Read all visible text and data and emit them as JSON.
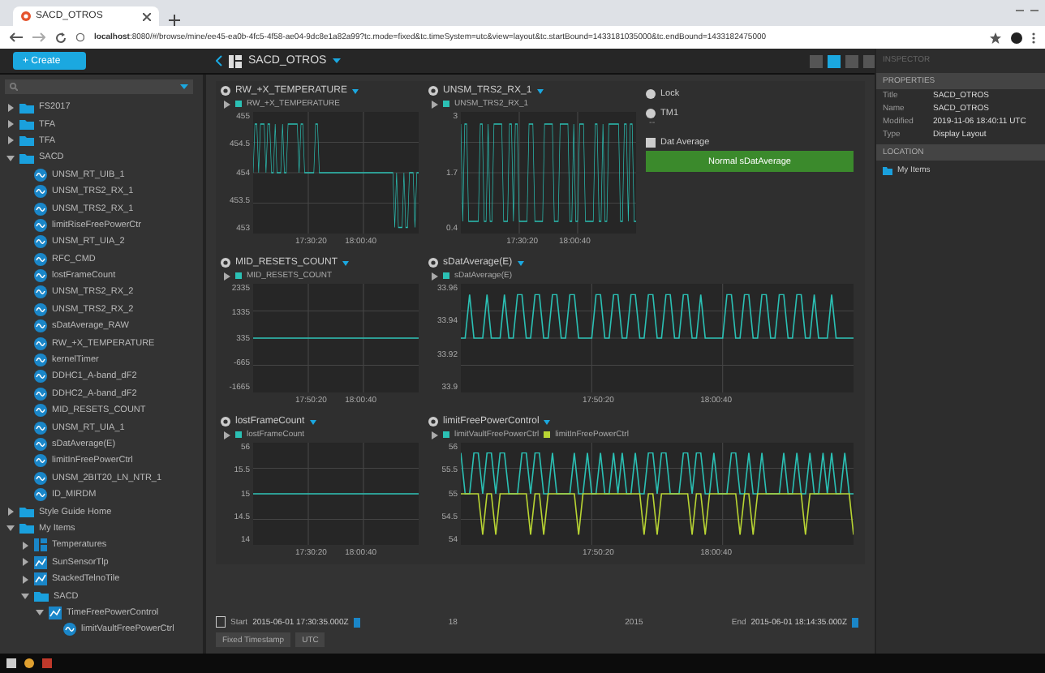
{
  "browser": {
    "tab_title": "SACD_OTROS",
    "url_host": "localhost",
    "url_rest": ":8080/#/browse/mine/ee45-ea0b-4fc5-4f58-ae04-9dc8e1a82a99?tc.mode=fixed&tc.timeSystem=utc&view=layout&tc.startBound=1433181035000&tc.endBound=1433182475000"
  },
  "create_button": "+ Create",
  "tree": [
    {
      "label": "FS2017",
      "kind": "folder",
      "expanded": false
    },
    {
      "label": "TFA",
      "kind": "folder",
      "expanded": false
    },
    {
      "label": "TFA",
      "kind": "folder",
      "expanded": false
    },
    {
      "label": "SACD",
      "kind": "folder",
      "expanded": true,
      "children": [
        {
          "label": "UNSM_RT_UIB_1",
          "kind": "telemetry"
        },
        {
          "label": "UNSM_TRS2_RX_1",
          "kind": "telemetry"
        },
        {
          "label": "UNSM_TRS2_RX_1",
          "kind": "telemetry"
        },
        {
          "label": "limitRiseFreePowerCtr",
          "kind": "telemetry"
        },
        {
          "label": "UNSM_RT_UIA_2",
          "kind": "telemetry"
        },
        {
          "label": "RFC_CMD",
          "kind": "telemetry"
        },
        {
          "label": "lostFrameCount",
          "kind": "telemetry"
        },
        {
          "label": "UNSM_TRS2_RX_2",
          "kind": "telemetry"
        },
        {
          "label": "UNSM_TRS2_RX_2",
          "kind": "telemetry"
        },
        {
          "label": "sDatAverage_RAW",
          "kind": "telemetry"
        },
        {
          "label": "RW_+X_TEMPERATURE",
          "kind": "telemetry"
        },
        {
          "label": "kernelTimer",
          "kind": "telemetry"
        },
        {
          "label": "DDHC1_A-band_dF2",
          "kind": "telemetry"
        },
        {
          "label": "DDHC2_A-band_dF2",
          "kind": "telemetry"
        },
        {
          "label": "MID_RESETS_COUNT",
          "kind": "telemetry"
        },
        {
          "label": "UNSM_RT_UIA_1",
          "kind": "telemetry"
        },
        {
          "label": "sDatAverage(E)",
          "kind": "telemetry"
        },
        {
          "label": "limitInFreePowerCtrl",
          "kind": "telemetry"
        },
        {
          "label": "UNSM_2BIT20_LN_NTR_1",
          "kind": "telemetry"
        },
        {
          "label": "ID_MIRDM",
          "kind": "telemetry"
        }
      ]
    },
    {
      "label": "Style Guide Home",
      "kind": "folder",
      "expanded": false
    },
    {
      "label": "My Items",
      "kind": "folder",
      "expanded": true,
      "children": [
        {
          "label": "Temperatures",
          "kind": "layout",
          "expanded": false
        },
        {
          "label": "SunSensorTlp",
          "kind": "plot",
          "expanded": false
        },
        {
          "label": "StackedTelnoTile",
          "kind": "plot",
          "expanded": false
        },
        {
          "label": "SACD",
          "kind": "folder",
          "expanded": true,
          "children": [
            {
              "label": "TimeFreePowerControl",
              "kind": "plot",
              "expanded": true,
              "children": [
                {
                  "label": "limitVaultFreePowerCtrl",
                  "kind": "telemetry"
                }
              ]
            }
          ]
        }
      ]
    }
  ],
  "layout_title": "SACD_OTROS",
  "plots": [
    {
      "title": "RW_+X_TEMPERATURE",
      "kind": "noisy",
      "series": [
        {
          "name": "RW_+X_TEMPERATURE",
          "color": "#2bc0b4"
        }
      ],
      "yticks": [
        "455",
        "454.5",
        "454",
        "453.5",
        "453"
      ],
      "xticks": [
        "17:30:20",
        "18:00:40"
      ]
    },
    {
      "title": "UNSM_TRS2_RX_1",
      "kind": "square",
      "series": [
        {
          "name": "UNSM_TRS2_RX_1",
          "color": "#2bc0b4"
        }
      ],
      "yticks": [
        "3",
        "1.7",
        "0.4"
      ],
      "xticks": [
        "17:30:20",
        "18:00:40"
      ]
    },
    {
      "title": "MID_RESETS_COUNT",
      "kind": "flat",
      "series": [
        {
          "name": "MID_RESETS_COUNT",
          "color": "#2bc0b4"
        }
      ],
      "yticks": [
        "2335",
        "1335",
        "335",
        "-665",
        "-1665"
      ],
      "xticks": [
        "17:50:20",
        "18:00:40"
      ]
    },
    {
      "title": "sDatAverage(E)",
      "kind": "square",
      "series": [
        {
          "name": "sDatAverage(E)",
          "color": "#2bc0b4"
        }
      ],
      "yticks": [
        "33.96",
        "33.94",
        "33.92",
        "33.9"
      ],
      "xticks": [
        "17:50:20",
        "18:00:40"
      ]
    },
    {
      "title": "lostFrameCount",
      "kind": "flat",
      "series": [
        {
          "name": "lostFrameCount",
          "color": "#2bc0b4"
        }
      ],
      "yticks": [
        "56",
        "15.5",
        "15",
        "14.5",
        "14"
      ],
      "xticks": [
        "17:30:20",
        "18:00:40"
      ]
    },
    {
      "title": "limitFreePowerControl",
      "kind": "square",
      "series": [
        {
          "name": "limitVaultFreePowerCtrl",
          "color": "#2bc0b4"
        },
        {
          "name": "limitInFreePowerCtrl",
          "color": "#b8d433"
        }
      ],
      "yticks": [
        "56",
        "55.5",
        "55",
        "54.5",
        "54"
      ],
      "xticks": [
        "17:50:20",
        "18:00:40"
      ]
    }
  ],
  "widgets": [
    {
      "kind": "lock",
      "label": "Lock"
    },
    {
      "kind": "value",
      "label": "TM1",
      "value": "--"
    },
    {
      "kind": "button",
      "label": "Dat Average",
      "button": "Normal sDatAverage"
    }
  ],
  "time_bar": {
    "start_label": "Start",
    "start": "2015-06-01 17:30:35.000Z",
    "ticks": [
      "18",
      "2015"
    ],
    "end_label": "End",
    "end": "2015-06-01 18:14:35.000Z",
    "mode": "Fixed Timestamp",
    "system": "UTC"
  },
  "inspector": {
    "title": "INSPECTOR",
    "properties_heading": "PROPERTIES",
    "properties": [
      {
        "key": "Title",
        "value": "SACD_OTROS"
      },
      {
        "key": "Name",
        "value": "SACD_OTROS"
      },
      {
        "key": "Modified",
        "value": "2019-11-06 18:40:11 UTC"
      },
      {
        "key": "Type",
        "value": "Display Layout"
      }
    ],
    "location_heading": "LOCATION",
    "location": "My Items"
  }
}
